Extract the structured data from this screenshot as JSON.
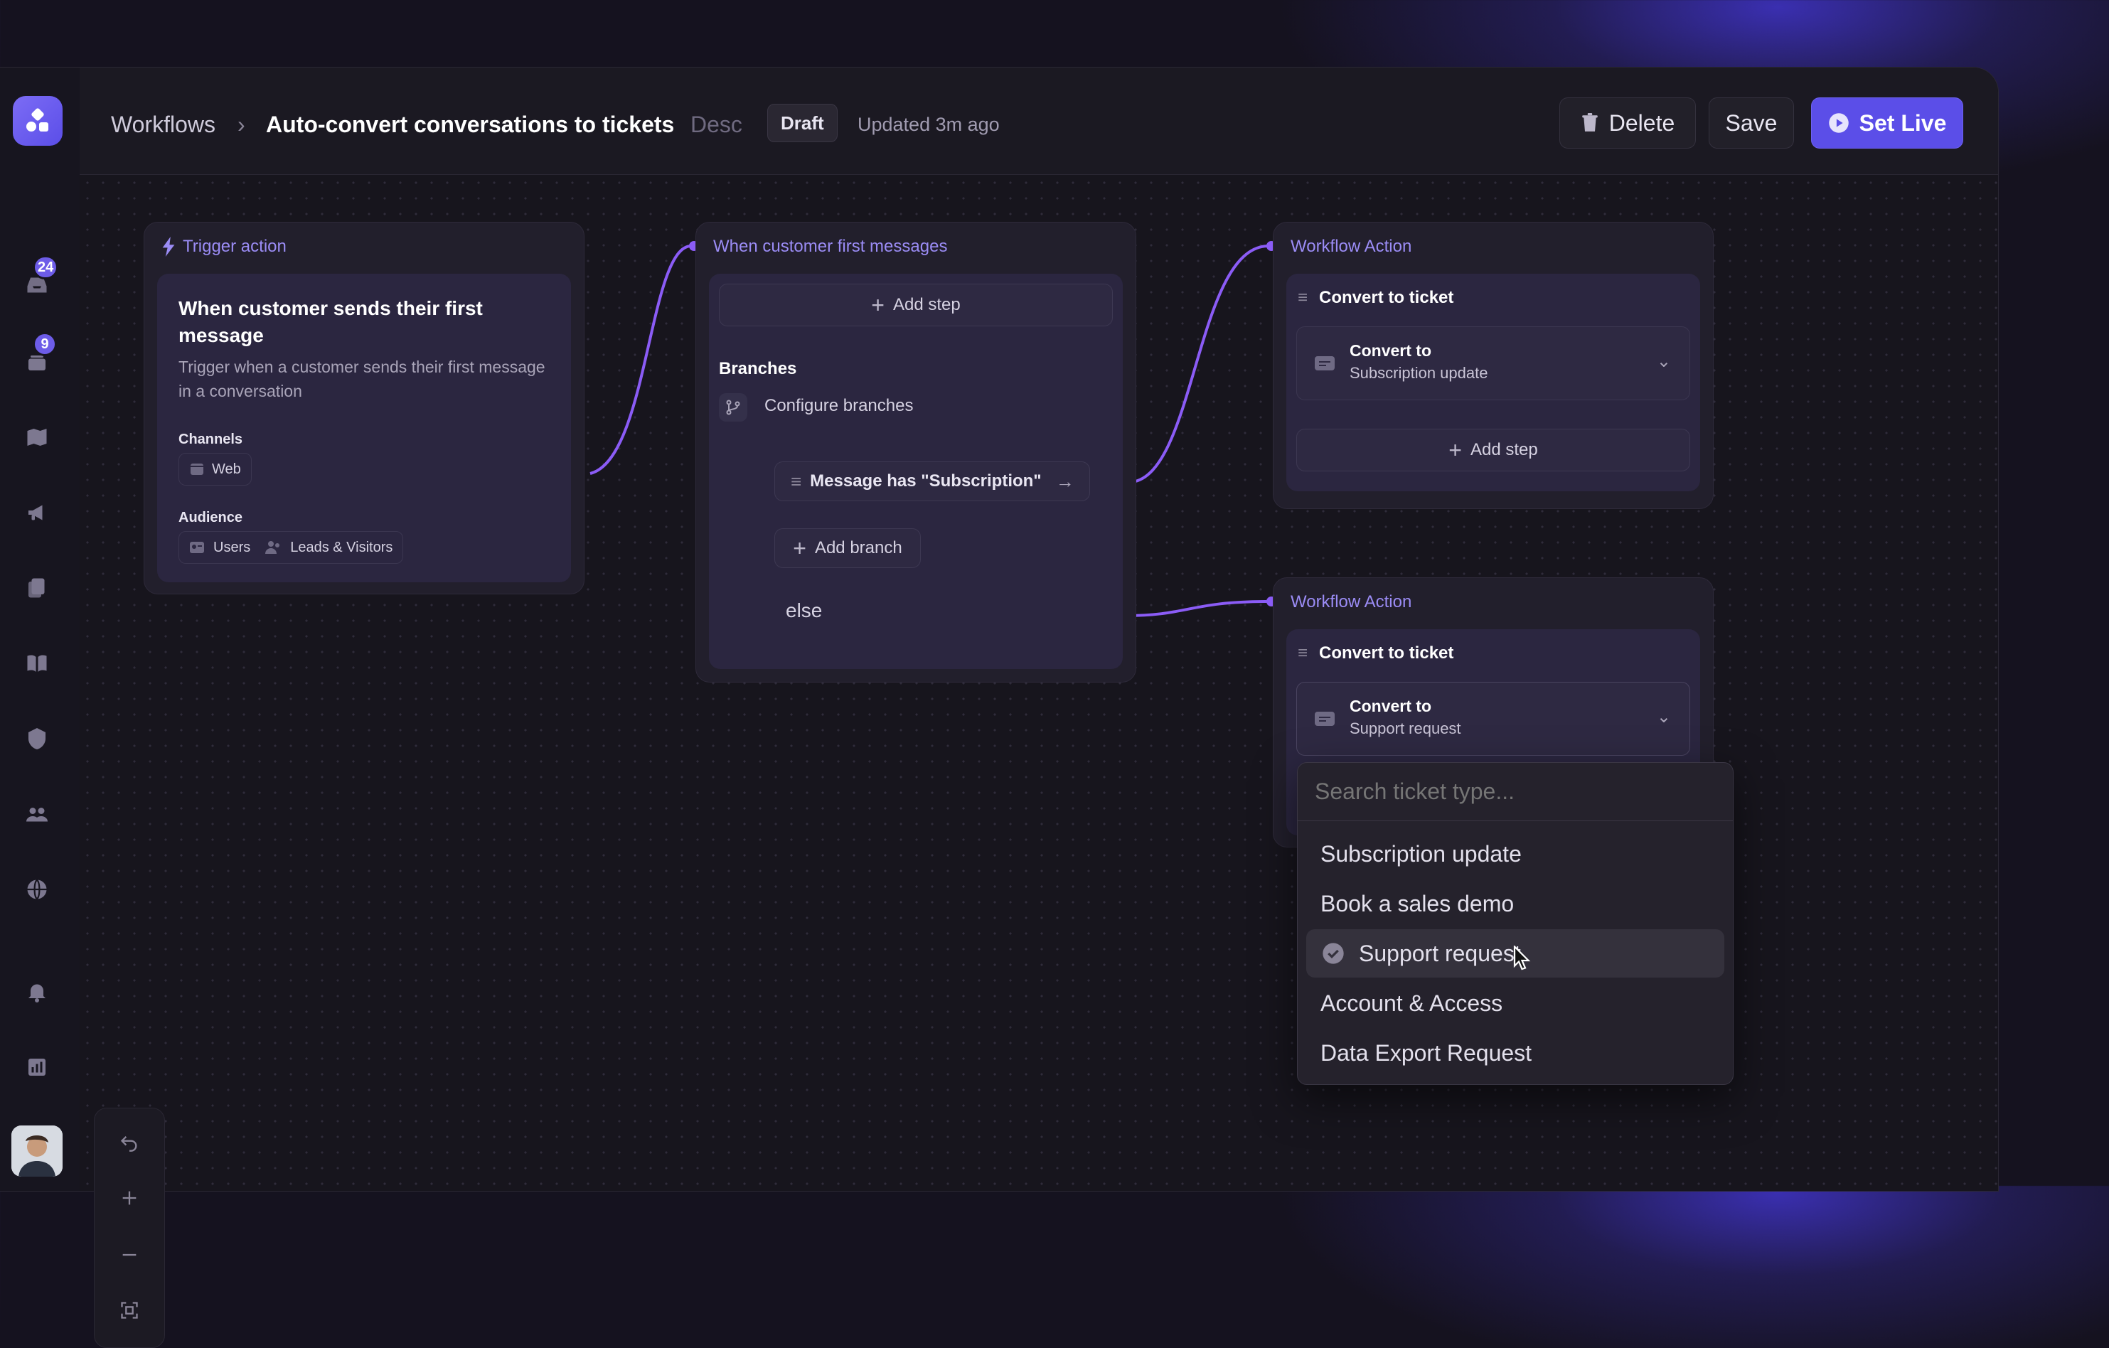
{
  "header": {
    "breadcrumb_root": "Workflows",
    "title": "Auto-convert conversations to tickets",
    "desc_label": "Desc",
    "status_badge": "Draft",
    "updated": "Updated 3m ago",
    "delete_label": "Delete",
    "save_label": "Save",
    "set_live_label": "Set Live"
  },
  "sidebar": {
    "inbox_badge": "24",
    "tickets_badge": "9",
    "icons": [
      "inbox-icon",
      "tickets-icon",
      "map-icon",
      "megaphone-icon",
      "documents-icon",
      "book-icon",
      "shield-icon",
      "contacts-icon",
      "globe-icon",
      "bell-icon",
      "reports-icon",
      "settings-icon"
    ]
  },
  "trigger": {
    "head": "Trigger action",
    "title": "When customer sends their first message",
    "description": "Trigger when a customer sends their first message in a conversation",
    "channels_label": "Channels",
    "channel": "Web",
    "audience_label": "Audience",
    "audience": [
      "Users",
      "Leads & Visitors"
    ]
  },
  "branch_card": {
    "head": "When customer first messages",
    "add_step": "Add step",
    "branches_label": "Branches",
    "configure": "Configure branches",
    "condition": "Message has \"Subscription\"",
    "add_branch": "Add branch",
    "else_label": "else"
  },
  "action1": {
    "head": "Workflow Action",
    "title": "Convert to ticket",
    "convert_label": "Convert to",
    "convert_value": "Subscription update",
    "add_step": "Add step"
  },
  "action2": {
    "head": "Workflow Action",
    "title": "Convert to ticket",
    "convert_label": "Convert to",
    "convert_value": "Support request"
  },
  "dropdown": {
    "placeholder": "Search ticket type...",
    "options": [
      "Subscription update",
      "Book a sales demo",
      "Support request",
      "Account & Access",
      "Data Export Request"
    ],
    "selected": "Support request"
  },
  "colors": {
    "accent": "#5b4ee8",
    "connector": "#8b5cf6",
    "head_text": "#9b8cf5"
  }
}
